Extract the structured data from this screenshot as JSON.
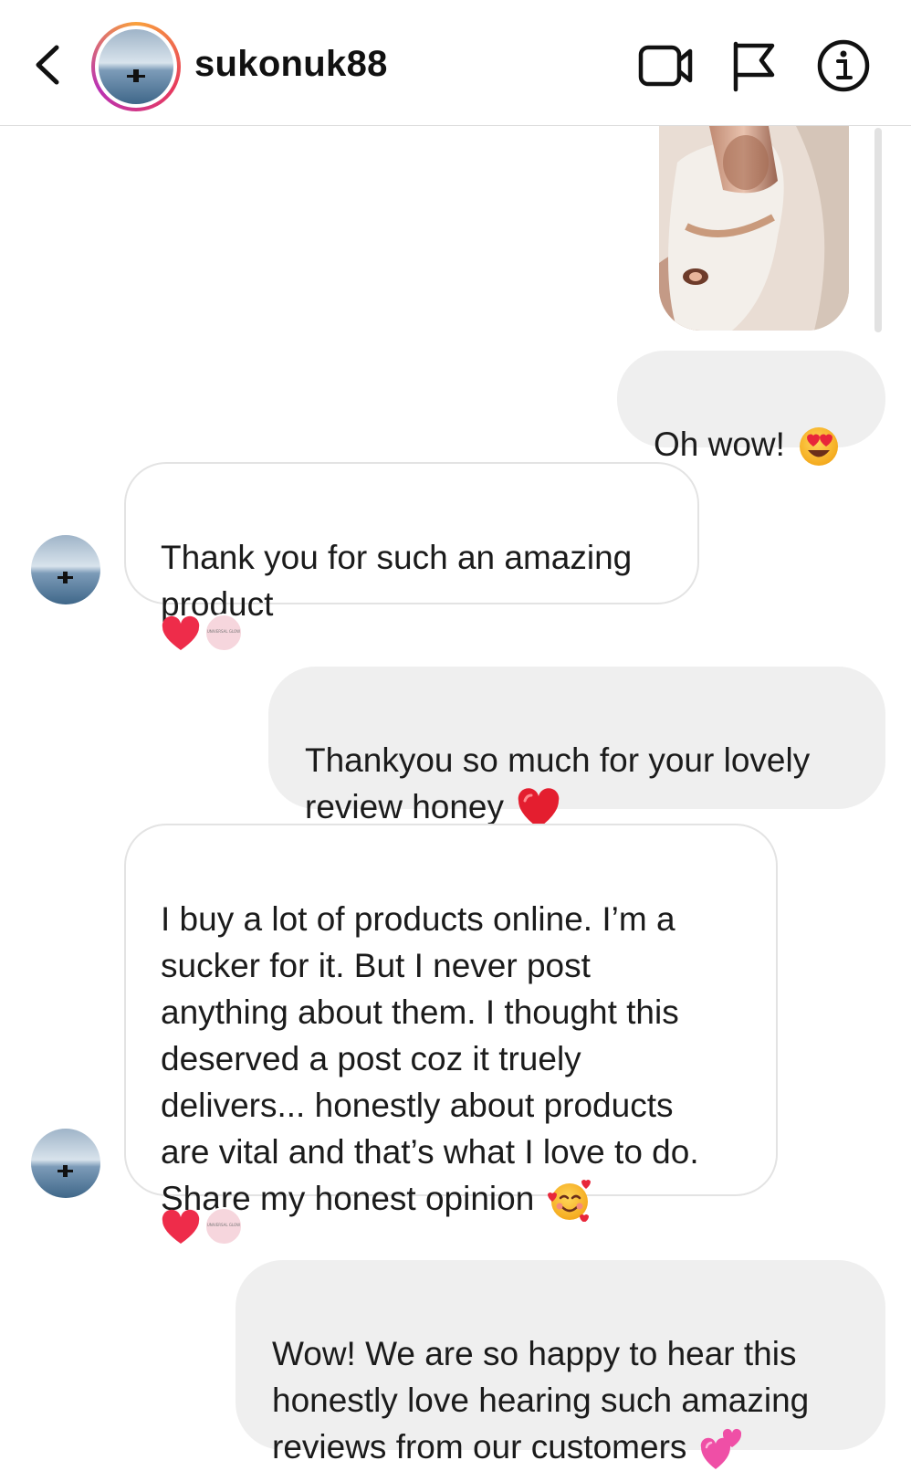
{
  "header": {
    "username": "sukonuk88",
    "back_icon": "chevron-left-icon",
    "video_icon": "video-camera-icon",
    "flag_icon": "flag-icon",
    "info_icon": "info-icon"
  },
  "colors": {
    "outgoing_bubble": "#efefef",
    "incoming_border": "#e3e3e3",
    "heart": "#ee2c4a",
    "ring_gradient": [
      "#f9a13c",
      "#e7395d",
      "#b932b4"
    ]
  },
  "messages": [
    {
      "direction": "outgoing",
      "type": "image",
      "content": "product-photo"
    },
    {
      "direction": "outgoing",
      "text": "Oh wow!",
      "emoji": "heart-eyes-emoji"
    },
    {
      "direction": "incoming",
      "text": "Thank you for such an amazing\nproduct",
      "reactions": [
        "heart-icon",
        "reactor-avatar"
      ],
      "reactor_label": "UNIVERSAL GLOW"
    },
    {
      "direction": "outgoing",
      "text": "Thankyou so much for your lovely\nreview honey",
      "emoji": "red-heart-emoji"
    },
    {
      "direction": "incoming",
      "text": "I buy a lot of products online. I’m a\nsucker for it. But I never post\nanything about them. I thought this\ndeserved a post coz it truely\ndelivers... honestly about products\nare vital and that’s what I love to do.\nShare my honest opinion",
      "emoji": "smiling-face-with-hearts-emoji",
      "reactions": [
        "heart-icon",
        "reactor-avatar"
      ],
      "reactor_label": "UNIVERSAL GLOW"
    },
    {
      "direction": "outgoing",
      "text": "Wow! We are so happy to hear this\nhonestly love hearing such amazing\nreviews from our customers",
      "emoji": "two-hearts-emoji"
    }
  ]
}
